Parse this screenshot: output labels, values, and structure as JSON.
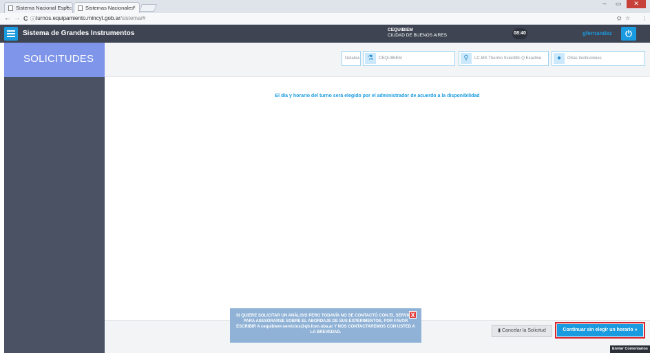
{
  "browser": {
    "tabs": [
      {
        "title": "Sistema Nacional Espec",
        "close": "×"
      },
      {
        "title": "Sistemas Nacionales",
        "close": "×"
      }
    ],
    "url_host": "turnos.equipamiento.mincyt.gob.ar",
    "url_path": "/sistema/#",
    "nav_back": "←",
    "nav_forward": "→",
    "reload": "C",
    "info": "ⓘ",
    "window_controls": {
      "minimize": "–",
      "maximize": "▭",
      "close": "✕"
    },
    "toolbar_icons": {
      "translate": "⛭",
      "star": "☆",
      "menu": "⋮"
    }
  },
  "header": {
    "title": "Sistema de Grandes Instrumentos",
    "institution": "CEQUIBIEM",
    "city": "CIUDAD DE BUENOS AIRES",
    "time": "08:40",
    "username": "gfernandez",
    "power_icon": "⏻"
  },
  "sidebar": {
    "heading": "SOLICITUDES"
  },
  "steps": {
    "details": "Detalles",
    "institution": "CEQUIBIEM",
    "instrument": "LC-MS Thermo Scientific Q Exactive",
    "others": "Otras Instituciones"
  },
  "main": {
    "notice": "El día y horario del turno será elegido por el administrador de acuerdo a la disponibilidad"
  },
  "toast": {
    "message": "SI QUIERE SOLICITAR UN ANÁLISIS PERO TODAVÍA NO SE CONTACTÓ CON EL SERVICIO PARA ASESORARSE SOBRE EL ABORDAJE DE SUS EXPERIMENTOS, POR FAVOR ESCRIBIR A cequibiem-servicios@qb.fcen.uba.ar Y NOS CONTACTAREMOS CON USTED A LA BREVEDAD.",
    "close": "X"
  },
  "actions": {
    "cancel": "Cancelar la Solicitud",
    "continue": "Continuar sin elegir un horario",
    "continue_glyph": "»",
    "feedback": "Enviar Comentarios"
  },
  "colors": {
    "accent": "#1a9be0",
    "header_bg": "#3f4452",
    "sidebar_bg": "#4b5264",
    "sidebar_head": "#7f95e9",
    "highlight": "#d9262f"
  }
}
